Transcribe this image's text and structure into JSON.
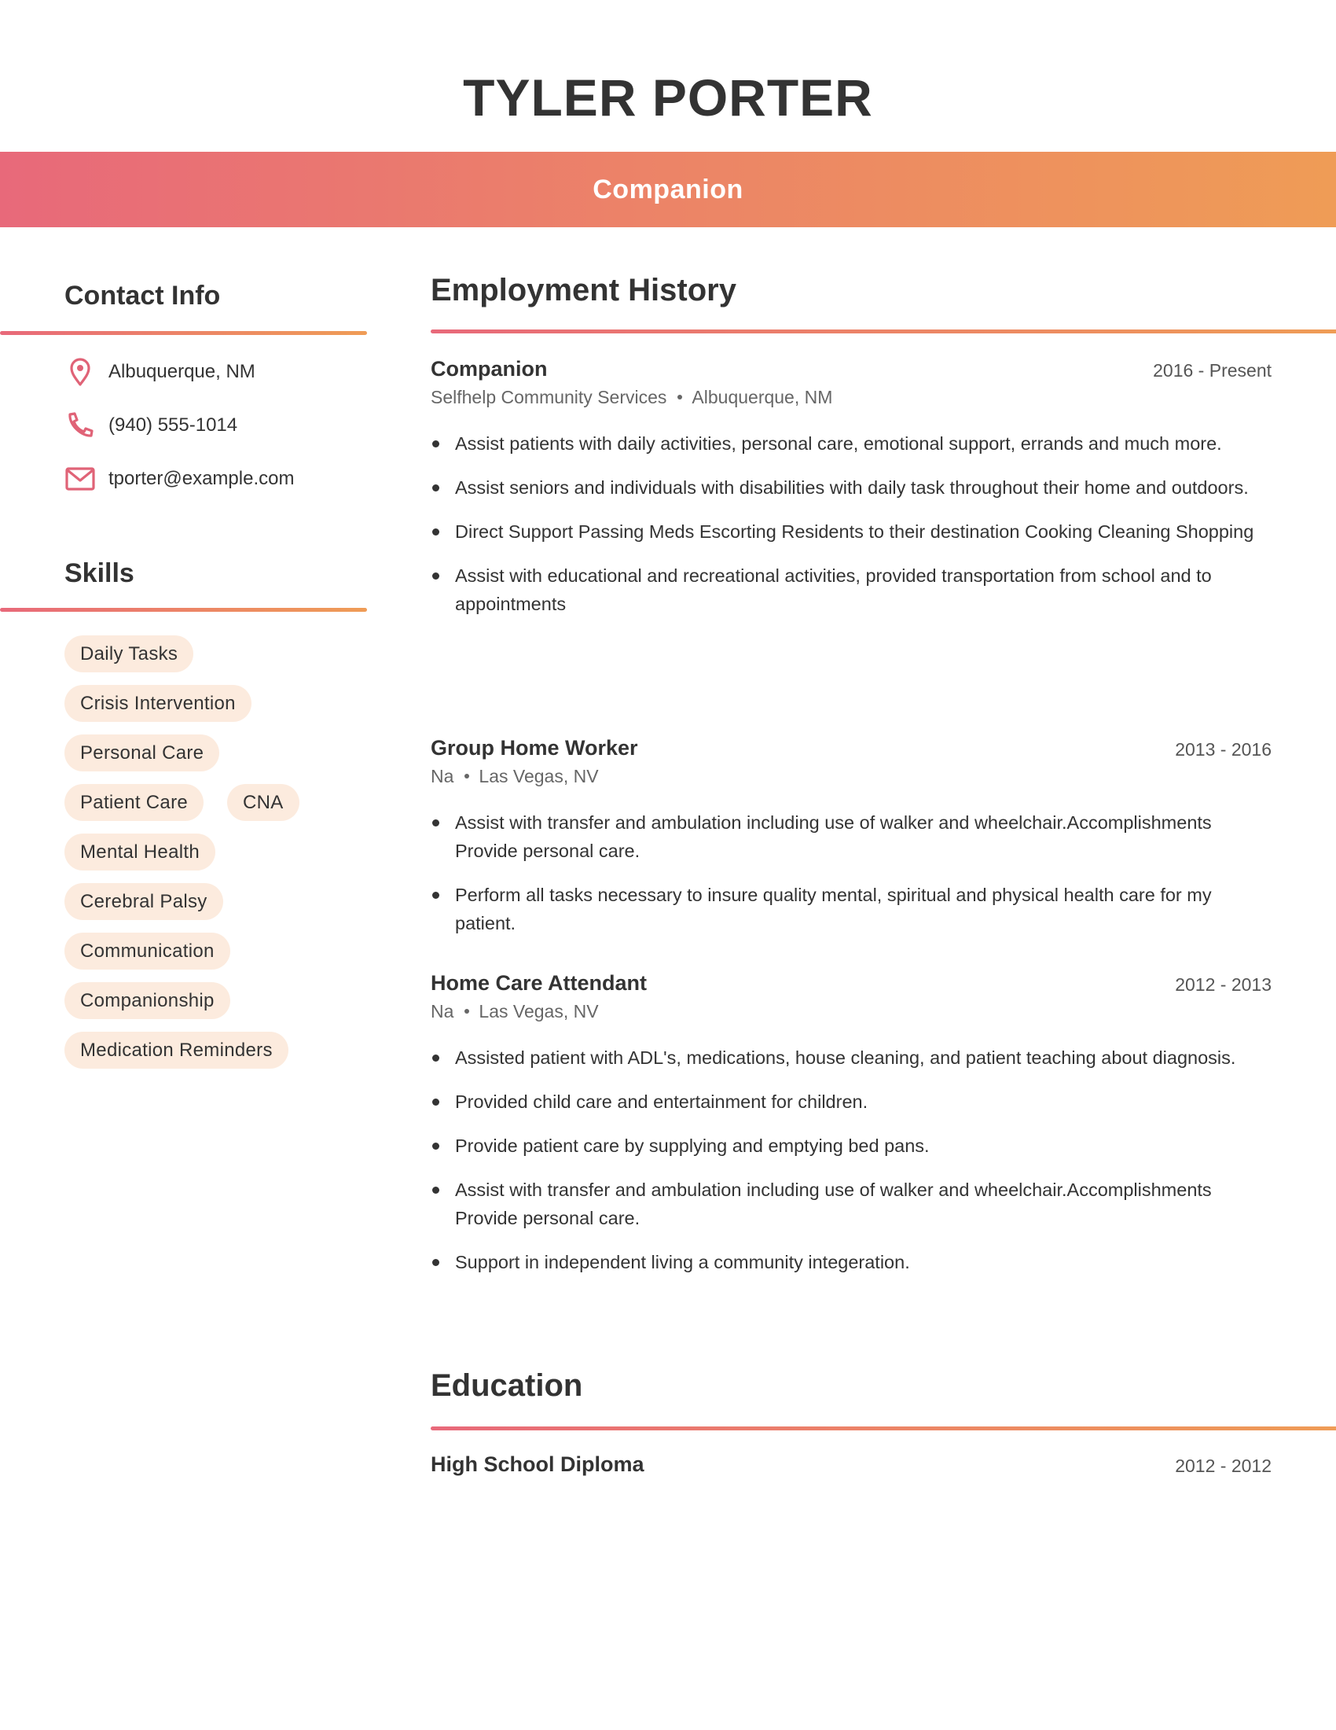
{
  "header": {
    "name": "TYLER PORTER",
    "job_title": "Companion"
  },
  "colors": {
    "accent_start": "#E8697A",
    "accent_end": "#EF9C56",
    "pill_background": "#FCEBDE",
    "icon": "#E06377",
    "text": "#333333"
  },
  "contact": {
    "heading": "Contact Info",
    "items": [
      {
        "icon": "location-pin-icon",
        "text": "Albuquerque, NM"
      },
      {
        "icon": "phone-icon",
        "text": "(940) 555-1014"
      },
      {
        "icon": "mail-icon",
        "text": "tporter@example.com"
      }
    ]
  },
  "skills": {
    "heading": "Skills",
    "items": [
      "Daily Tasks",
      "Crisis Intervention",
      "Personal Care",
      "Patient Care",
      "CNA",
      "Mental Health",
      "Cerebral Palsy",
      "Communication",
      "Companionship",
      "Medication Reminders"
    ]
  },
  "employment": {
    "heading": "Employment History",
    "jobs": [
      {
        "title": "Companion",
        "dates": "2016 - Present",
        "employer": "Selfhelp Community Services",
        "location": "Albuquerque, NM",
        "bullets": [
          "Assist patients with daily activities, personal care, emotional support, errands and much more.",
          "Assist seniors and individuals with disabilities with daily task throughout their home and outdoors.",
          "Direct Support Passing Meds Escorting Residents to their destination Cooking Cleaning Shopping",
          "Assist with educational and recreational activities, provided transportation from school and to appointments"
        ]
      },
      {
        "title": "Group Home Worker",
        "dates": "2013 - 2016",
        "employer": "Na",
        "location": "Las Vegas, NV",
        "bullets": [
          "Assist with transfer and ambulation including use of walker and wheelchair.Accomplishments Provide personal care.",
          "Perform all tasks necessary to insure quality mental, spiritual and physical health care for my patient."
        ]
      },
      {
        "title": "Home Care Attendant",
        "dates": "2012 - 2013",
        "employer": "Na",
        "location": "Las Vegas, NV",
        "bullets": [
          "Assisted patient with ADL's, medications, house cleaning, and patient teaching about diagnosis.",
          "Provided child care and entertainment for children.",
          "Provide patient care by supplying and emptying bed pans.",
          "Assist with transfer and ambulation including use of walker and wheelchair.Accomplishments Provide personal care.",
          "Support in independent living a community integeration."
        ]
      }
    ]
  },
  "education": {
    "heading": "Education",
    "items": [
      {
        "title": "High School Diploma",
        "dates": "2012 - 2012"
      }
    ]
  }
}
